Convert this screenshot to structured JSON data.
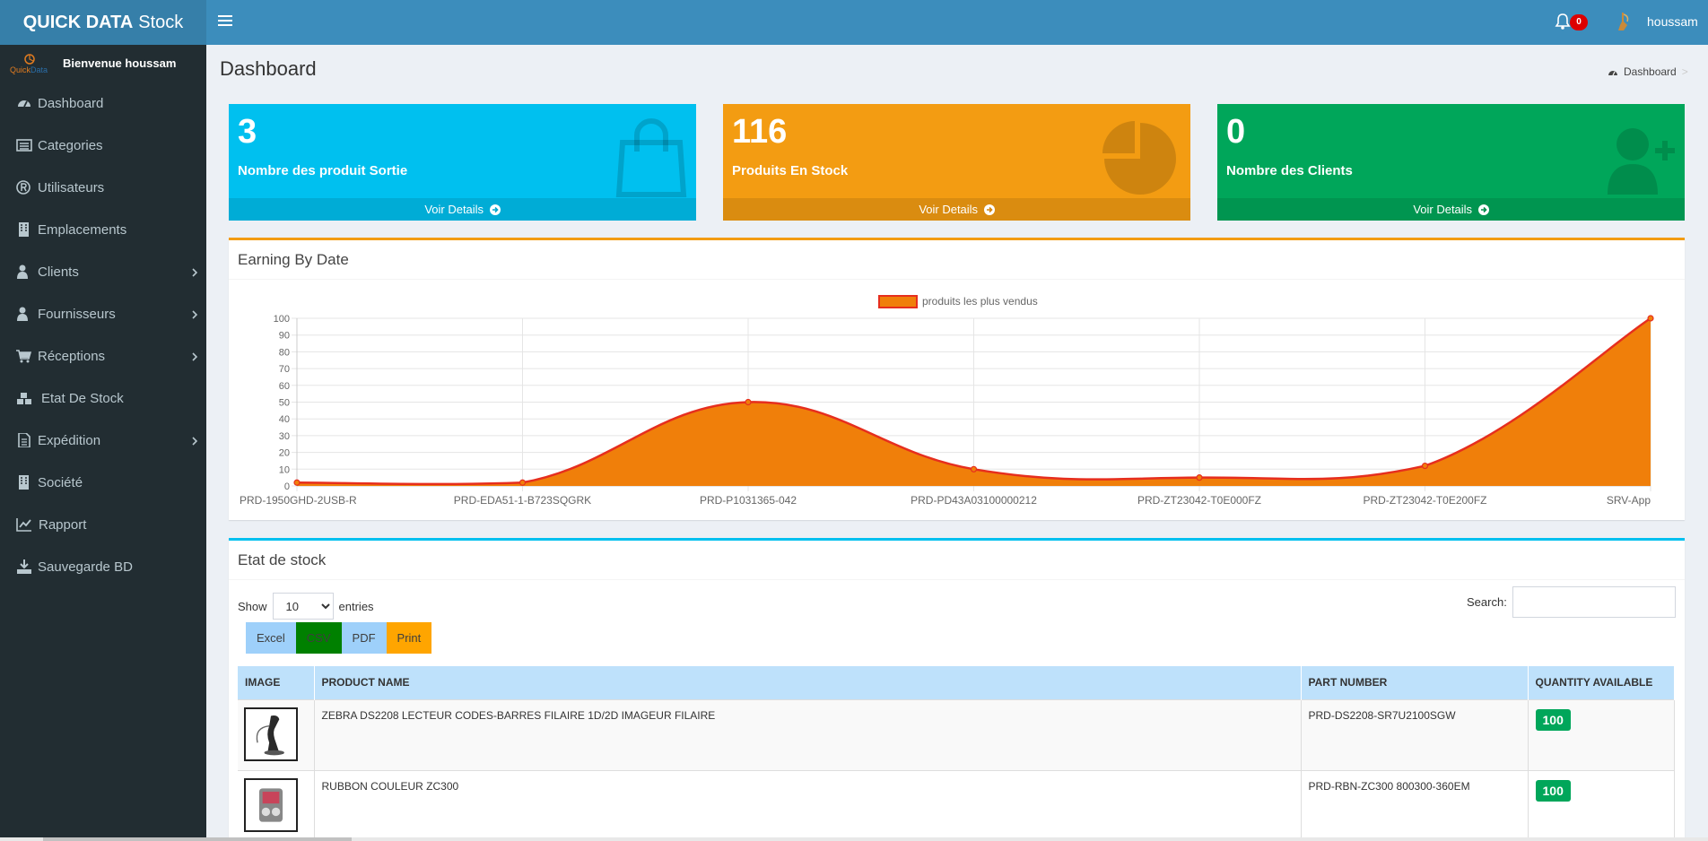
{
  "app": {
    "brand_bold": "QUICK DATA",
    "brand_light": "Stock"
  },
  "header": {
    "notifications": "0",
    "user": "houssam"
  },
  "sidebar": {
    "welcome": "Bienvenue houssam",
    "items": [
      {
        "label": "Dashboard",
        "icon": "dashboard-icon",
        "has_children": false
      },
      {
        "label": "Categories",
        "icon": "list-icon",
        "has_children": false
      },
      {
        "label": "Utilisateurs",
        "icon": "registered-icon",
        "has_children": false
      },
      {
        "label": "Emplacements",
        "icon": "building-icon",
        "has_children": false
      },
      {
        "label": "Clients",
        "icon": "user-icon",
        "has_children": true
      },
      {
        "label": "Fournisseurs",
        "icon": "user-icon",
        "has_children": true
      },
      {
        "label": "Réceptions",
        "icon": "cart-icon",
        "has_children": true
      },
      {
        "label": "Etat De Stock",
        "icon": "cubes-icon",
        "has_children": false
      },
      {
        "label": "Expédition",
        "icon": "file-icon",
        "has_children": true
      },
      {
        "label": "Société",
        "icon": "building-icon",
        "has_children": false
      },
      {
        "label": "Rapport",
        "icon": "line-chart-icon",
        "has_children": false
      },
      {
        "label": "Sauvegarde BD",
        "icon": "download-icon",
        "has_children": false
      }
    ]
  },
  "page": {
    "title": "Dashboard",
    "breadcrumb": "Dashboard",
    "breadcrumb_sep": ">"
  },
  "info_boxes": [
    {
      "value": "3",
      "label": "Nombre des produit Sortie",
      "link": "Voir Details",
      "color": "#00c0ef",
      "icon": "shopping-bag-icon"
    },
    {
      "value": "116",
      "label": "Produits En Stock",
      "link": "Voir Details",
      "color": "#f39c12",
      "icon": "pie-chart-icon"
    },
    {
      "value": "0",
      "label": "Nombre des Clients",
      "link": "Voir Details",
      "color": "#00a65a",
      "icon": "user-plus-icon"
    }
  ],
  "chart_box": {
    "title": "Earning By Date",
    "accent": "#f39c12"
  },
  "chart_data": {
    "type": "area",
    "categories": [
      "PRD-1950GHD-2USB-R",
      "PRD-EDA51-1-B723SQGRK",
      "PRD-P1031365-042",
      "PRD-PD43A03100000212",
      "PRD-ZT23042-T0E000FZ",
      "PRD-ZT23042-T0E200FZ",
      "SRV-App"
    ],
    "series": [
      {
        "name": "produits les plus vendus",
        "values": [
          2,
          2,
          50,
          10,
          5,
          12,
          100
        ],
        "fill": "#f07f0a",
        "stroke": "#e62e1e"
      }
    ],
    "ylim": [
      0,
      100
    ],
    "yticks": [
      0,
      10,
      20,
      30,
      40,
      50,
      60,
      70,
      80,
      90,
      100
    ],
    "grid": true,
    "legend": "top-center"
  },
  "stock_box": {
    "title": "Etat de stock",
    "accent": "#00c0ef",
    "show": "Show",
    "entries": "entries",
    "page_size": "10",
    "search_label": "Search:",
    "buttons": [
      {
        "label": "Excel",
        "color": "#9ed0fa"
      },
      {
        "label": "CSV",
        "color": "#008000"
      },
      {
        "label": "PDF",
        "color": "#9ed0fa"
      },
      {
        "label": "Print",
        "color": "#ffa500"
      }
    ],
    "columns": [
      "IMAGE",
      "PRODUCT NAME",
      "PART NUMBER",
      "QUANTITY AVAILABLE"
    ],
    "rows": [
      {
        "image": "barcode-scanner-image",
        "name": "ZEBRA DS2208 LECTEUR CODES-BARRES FILAIRE 1D/2D IMAGEUR FILAIRE",
        "part": "PRD-DS2208-SR7U2100SGW",
        "qty": "100"
      },
      {
        "image": "ribbon-image",
        "name": "RUBBON COULEUR ZC300",
        "part": "PRD-RBN-ZC300 800300-360EM",
        "qty": "100"
      }
    ]
  }
}
